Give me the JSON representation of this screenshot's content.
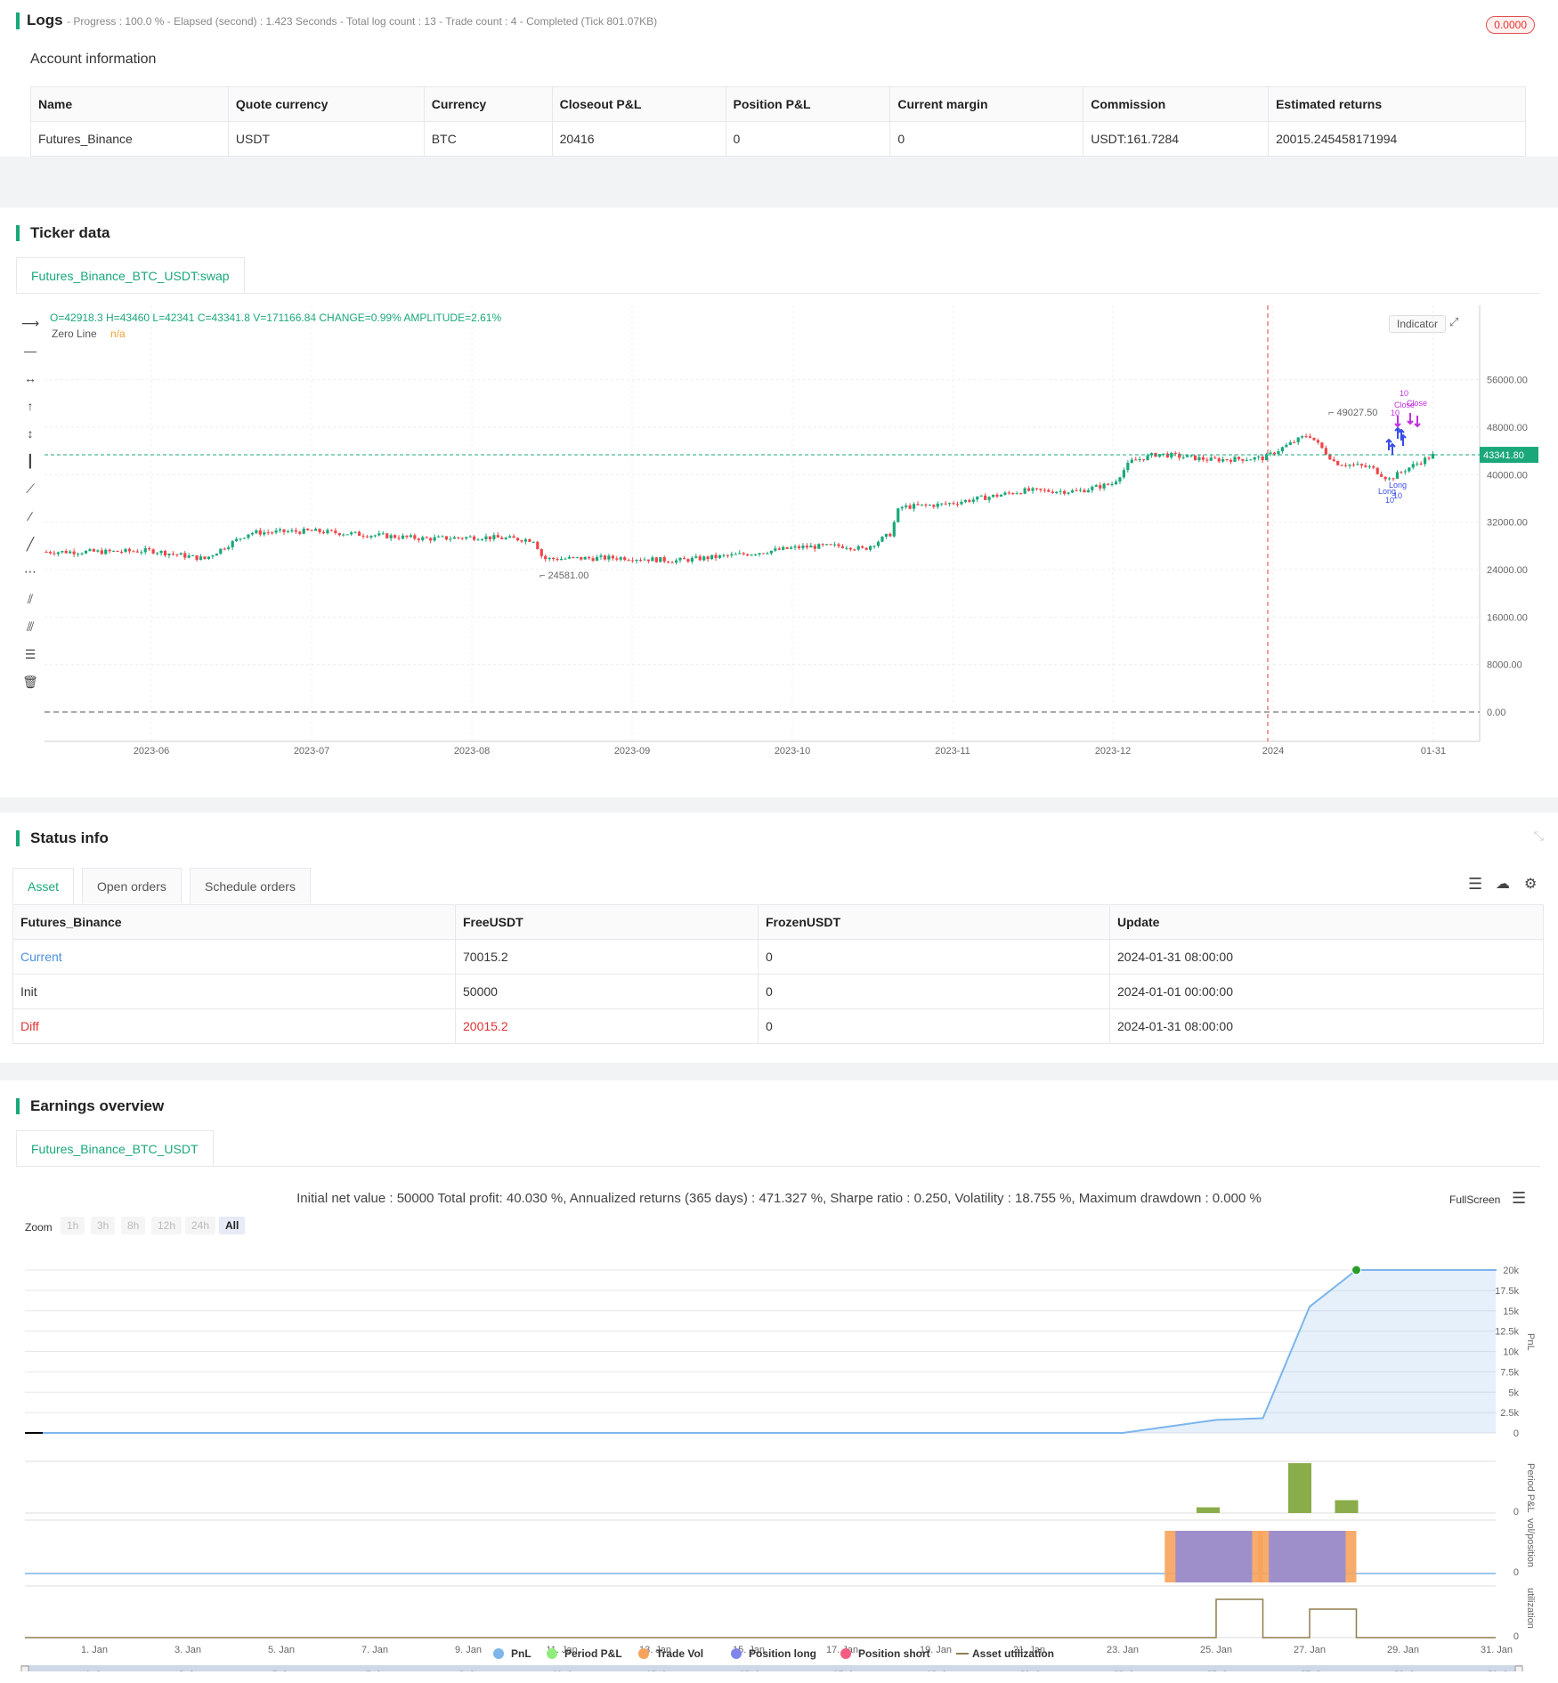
{
  "logs": {
    "title": "Logs",
    "meta": "- Progress : 100.0 % - Elapsed (second) : 1.423  Seconds - Total log count : 13 - Trade count : 4 - Completed (Tick 801.07KB)",
    "badge": "0.0000"
  },
  "account": {
    "title": "Account information",
    "headers": [
      "Name",
      "Quote currency",
      "Currency",
      "Closeout P&L",
      "Position P&L",
      "Current margin",
      "Commission",
      "Estimated returns"
    ],
    "row": [
      "Futures_Binance",
      "USDT",
      "BTC",
      "20416",
      "0",
      "0",
      "USDT:161.7284",
      "20015.245458171994"
    ]
  },
  "ticker": {
    "title": "Ticker data",
    "tab": "Futures_Binance_BTC_USDT:swap",
    "ohlc": "O=42918.3 H=43460 L=42341 C=43341.8 V=171166.84 CHANGE=0.99% AMPLITUDE=2.61%",
    "zero_line_label": "Zero Line",
    "zero_line_value": "n/a",
    "indicator_btn": "Indicator",
    "price_tag": "43341.80",
    "high_label": "49027.50",
    "low_label": "24581.00",
    "y_ticks": [
      "56000.00",
      "48000.00",
      "40000.00",
      "32000.00",
      "24000.00",
      "16000.00",
      "8000.00",
      "0.00"
    ],
    "x_ticks": [
      "2023-06",
      "2023-07",
      "2023-08",
      "2023-09",
      "2023-10",
      "2023-11",
      "2023-12",
      "2024",
      "01-31"
    ],
    "markers": {
      "long": "Long",
      "ten": "10",
      "close": "Close"
    }
  },
  "status": {
    "title": "Status info",
    "tabs": [
      "Asset",
      "Open orders",
      "Schedule orders"
    ],
    "headers": [
      "Futures_Binance",
      "FreeUSDT",
      "FrozenUSDT",
      "Update"
    ],
    "rows": [
      [
        "Current",
        "70015.2",
        "0",
        "2024-01-31 08:00:00"
      ],
      [
        "Init",
        "50000",
        "0",
        "2024-01-01 00:00:00"
      ],
      [
        "Diff",
        "20015.2",
        "0",
        "2024-01-31 08:00:00"
      ]
    ]
  },
  "earnings": {
    "title": "Earnings overview",
    "tab": "Futures_Binance_BTC_USDT",
    "summary": "Initial net value : 50000 Total profit: 40.030 %, Annualized returns (365 days) : 471.327 %, Sharpe ratio : 0.250, Volatility : 18.755 %, Maximum drawdown : 0.000 %",
    "fullscreen": "FullScreen",
    "zoom_label": "Zoom",
    "zoom_options": [
      "1h",
      "3h",
      "8h",
      "12h",
      "24h",
      "All"
    ],
    "pnl_ticks": [
      "20k",
      "17.5k",
      "15k",
      "12.5k",
      "10k",
      "7.5k",
      "5k",
      "2.5k",
      "0"
    ],
    "axis_names": [
      "PnL",
      "Period P&L",
      "vol/position",
      "utilization"
    ],
    "zero": "0",
    "x_ticks": [
      "1. Jan",
      "3. Jan",
      "5. Jan",
      "7. Jan",
      "9. Jan",
      "11. Jan",
      "13. Jan",
      "15. Jan",
      "17. Jan",
      "19. Jan",
      "21. Jan",
      "23. Jan",
      "25. Jan",
      "27. Jan",
      "29. Jan",
      "31. Jan"
    ],
    "legend": [
      "PnL",
      "Period P&L",
      "Trade Vol",
      "Position long",
      "Position short",
      "Asset utilization"
    ],
    "colors": {
      "pnl": "#7cb5ec",
      "period": "#90ed7d",
      "vol": "#f7a35c",
      "long": "#8085e9",
      "short": "#f15c80",
      "util": "#8d7f4f"
    }
  },
  "chart_data": {
    "type": "line",
    "title": "",
    "series": [
      {
        "name": "PnL",
        "x": [
          "1. Jan",
          "23. Jan",
          "25. Jan",
          "26. Jan",
          "27. Jan",
          "28. Jan",
          "31. Jan"
        ],
        "values": [
          0,
          0,
          1600,
          1800,
          15500,
          20000,
          20000
        ]
      },
      {
        "name": "Period P&L",
        "x": [
          "25. Jan",
          "27. Jan",
          "28. Jan"
        ],
        "values": [
          400,
          3500,
          900
        ]
      }
    ],
    "ylim": [
      0,
      20000
    ]
  }
}
